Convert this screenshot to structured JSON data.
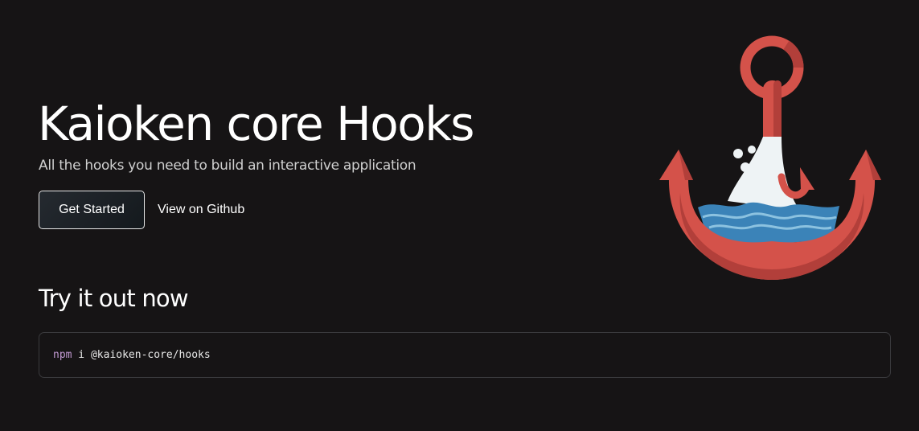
{
  "hero": {
    "title": "Kaioken core Hooks",
    "subtitle": "All the hooks you need to build an interactive application",
    "primary_button": "Get Started",
    "secondary_link": "View on Github"
  },
  "try_section": {
    "title": "Try it out now",
    "code": {
      "command": "npm",
      "args": " i @kaioken-core/hooks"
    }
  },
  "illustration": {
    "icon": "anchor-icon",
    "colors": {
      "anchor_red": "#d4524a",
      "anchor_dark_red": "#b23f3a",
      "water_blue": "#3b83b8",
      "splash_white": "#eef3f5"
    }
  },
  "theme": {
    "background": "#161415",
    "text": "#ffffff",
    "muted_text": "#cfcfcf",
    "code_command": "#c39bd3"
  }
}
